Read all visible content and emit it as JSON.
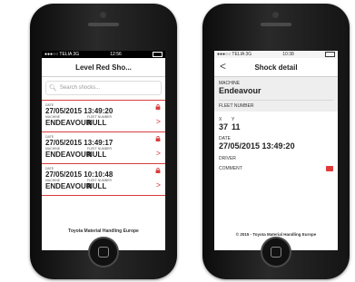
{
  "left": {
    "status": {
      "carrier": "TELIA",
      "network": "3G",
      "time": "12:56"
    },
    "title": "Level Red Sho...",
    "search_placeholder": "Search shocks...",
    "labels": {
      "date": "DATE",
      "machine": "MACHINE",
      "fleet": "FLEET NUMBER"
    },
    "items": [
      {
        "date": "27/05/2015 13:49:20",
        "machine": "ENDEAVOUR",
        "fleet": "NULL"
      },
      {
        "date": "27/05/2015 13:49:17",
        "machine": "ENDEAVOUR",
        "fleet": "NULL"
      },
      {
        "date": "27/05/2015 10:10:48",
        "machine": "ENDEAVOUR",
        "fleet": "NULL"
      }
    ],
    "footer": "Toyota Material Handling Europe"
  },
  "right": {
    "status": {
      "carrier": "TELIA",
      "network": "3G",
      "time": "10:38"
    },
    "title": "Shock detail",
    "machine_label": "MACHINE",
    "machine_value": "Endeavour",
    "fleet_label": "FLEET NUMBER",
    "x_label": "X",
    "y_label": "Y",
    "x_value": "37",
    "y_value": "11",
    "date_label": "DATE",
    "date_value": "27/05/2015 13:49:20",
    "driver_label": "DRIVER",
    "comment_label": "COMMENT",
    "footer": "© 2015 - Toyota Material Handling Europe"
  },
  "colors": {
    "accent": "#d83c3c"
  },
  "icons": [
    "search-icon",
    "lock-icon",
    "chevron-right-icon",
    "back-chevron-icon",
    "comment-flag-icon",
    "battery-icon"
  ]
}
